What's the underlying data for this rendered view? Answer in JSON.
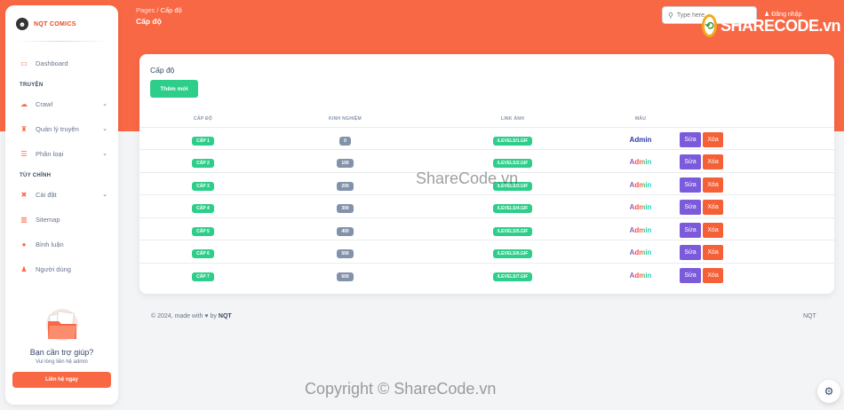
{
  "brand": {
    "name": "NQT COMICS"
  },
  "sidebar": {
    "items": [
      {
        "label": "Dashboard",
        "icon": "monitor-icon"
      },
      {
        "label": "Crawl",
        "icon": "cloud-icon"
      },
      {
        "label": "Quản lý truyện",
        "icon": "trophy-icon"
      },
      {
        "label": "Phân loại",
        "icon": "list-icon"
      },
      {
        "label": "Cài đặt",
        "icon": "tools-icon"
      },
      {
        "label": "Sitemap",
        "icon": "sitemap-icon"
      },
      {
        "label": "Bình luận",
        "icon": "comment-icon"
      },
      {
        "label": "Người dùng",
        "icon": "user-icon"
      }
    ],
    "sections": [
      "TRUYỆN",
      "TÙY CHỈNH"
    ]
  },
  "help": {
    "title": "Bạn cần trợ giúp?",
    "subtitle": "Vui lòng liên hệ admin",
    "button": "Liên hệ ngay"
  },
  "header": {
    "breadcrumb_root": "Pages",
    "breadcrumb_sep": "/",
    "breadcrumb_current": "Cấp độ",
    "title": "Cấp độ",
    "search_placeholder": "Type here...",
    "signin": "Đăng nhập"
  },
  "card": {
    "title": "Cấp độ",
    "add_button": "Thêm mới",
    "columns": [
      "Cấp độ",
      "Kinh nghiệm",
      "Link ảnh",
      "Mẫu",
      ""
    ],
    "rows": [
      {
        "level": "Cấp 1",
        "exp": "0",
        "img": "/levels/1.gif",
        "sample": "Admin"
      },
      {
        "level": "Cấp 2",
        "exp": "100",
        "img": "/levels/2.gif",
        "sample": "Admin"
      },
      {
        "level": "Cấp 3",
        "exp": "200",
        "img": "/levels/3.gif",
        "sample": "Admin"
      },
      {
        "level": "Cấp 4",
        "exp": "300",
        "img": "/levels/4.gif",
        "sample": "Admin"
      },
      {
        "level": "Cấp 5",
        "exp": "400",
        "img": "/levels/5.gif",
        "sample": "Admin"
      },
      {
        "level": "Cấp 6",
        "exp": "500",
        "img": "/levels/6.gif",
        "sample": "Admin"
      },
      {
        "level": "Cấp 7",
        "exp": "600",
        "img": "/levels/7.gif",
        "sample": "Admin"
      }
    ],
    "edit_label": "Sửa",
    "delete_label": "Xóa"
  },
  "footer": {
    "left_prefix": "© 2024, made with",
    "left_by": "by",
    "left_author": "NQT",
    "right": "NQT"
  },
  "watermark": {
    "center": "ShareCode.vn",
    "bottom": "Copyright © ShareCode.vn",
    "logo": "SHARECODE.vn"
  },
  "colors": {
    "accent": "#f96845",
    "success": "#2dce89",
    "edit": "#7b5bdb",
    "delete": "#f56036"
  }
}
